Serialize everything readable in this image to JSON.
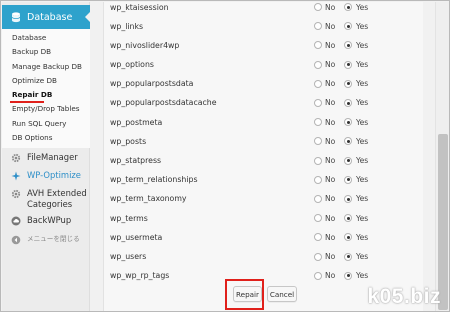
{
  "sidebar": {
    "header": {
      "label": "Database",
      "icon": "database-icon"
    },
    "submenu": [
      {
        "label": "Database"
      },
      {
        "label": "Backup DB"
      },
      {
        "label": "Manage Backup DB"
      },
      {
        "label": "Optimize DB"
      },
      {
        "label": "Repair DB",
        "current": true
      },
      {
        "label": "Empty/Drop Tables"
      },
      {
        "label": "Run SQL Query"
      },
      {
        "label": "DB Options"
      }
    ],
    "menu": [
      {
        "label": "FileManager",
        "icon": "gear-icon"
      },
      {
        "label": "WP-Optimize",
        "icon": "sparkle-icon"
      },
      {
        "label": "AVH Extended Categories",
        "icon": "gear-icon"
      },
      {
        "label": "BackWPup",
        "icon": "cloud-icon"
      },
      {
        "label": "メニューを閉じる",
        "icon": "collapse-icon"
      }
    ]
  },
  "options": {
    "no": "No",
    "yes": "Yes"
  },
  "tables": [
    {
      "name": "wp_ktaisession",
      "value": "Yes"
    },
    {
      "name": "wp_links",
      "value": "Yes"
    },
    {
      "name": "wp_nivoslider4wp",
      "value": "Yes"
    },
    {
      "name": "wp_options",
      "value": "Yes"
    },
    {
      "name": "wp_popularpostsdata",
      "value": "Yes"
    },
    {
      "name": "wp_popularpostsdatacache",
      "value": "Yes"
    },
    {
      "name": "wp_postmeta",
      "value": "Yes"
    },
    {
      "name": "wp_posts",
      "value": "Yes"
    },
    {
      "name": "wp_statpress",
      "value": "Yes"
    },
    {
      "name": "wp_term_relationships",
      "value": "Yes"
    },
    {
      "name": "wp_term_taxonomy",
      "value": "Yes"
    },
    {
      "name": "wp_terms",
      "value": "Yes"
    },
    {
      "name": "wp_usermeta",
      "value": "Yes"
    },
    {
      "name": "wp_users",
      "value": "Yes"
    },
    {
      "name": "wp_wp_rp_tags",
      "value": "Yes"
    }
  ],
  "actions": {
    "repair": "Repair",
    "cancel": "Cancel"
  },
  "watermark": "k05.biz",
  "colors": {
    "accent": "#2ea2cc",
    "highlight": "#e0201b"
  }
}
